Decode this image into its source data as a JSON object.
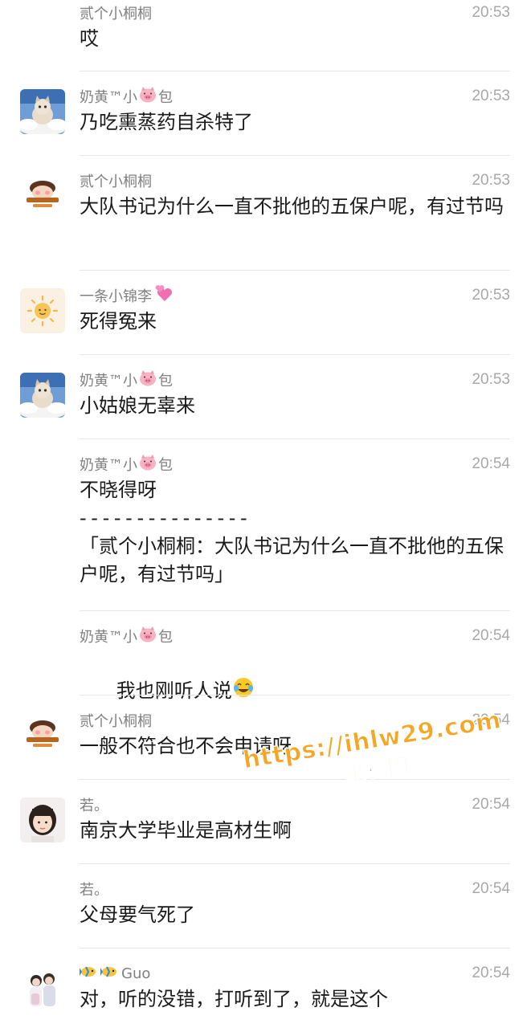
{
  "messages": [
    {
      "sender": "贰个小桐桐",
      "time": "20:53",
      "text": "哎",
      "avatar": "none"
    },
    {
      "sender": "奶黄™小",
      "sender_suffix": "包",
      "time": "20:53",
      "text": "乃吃熏蒸药自杀特了",
      "avatar": "cat-cloud"
    },
    {
      "sender": "贰个小桐桐",
      "time": "20:53",
      "text": "大队书记为什么一直不批他的五保户呢，有过节吗",
      "avatar": "cartoon-tongtong"
    },
    {
      "sender": "一条小锦李",
      "time": "20:53",
      "text": "死得冤来",
      "avatar": "sun"
    },
    {
      "sender": "奶黄™小",
      "sender_suffix": "包",
      "time": "20:53",
      "text": "小姑娘无辜来",
      "avatar": "cat-cloud"
    },
    {
      "sender": "奶黄™小",
      "sender_suffix": "包",
      "time": "20:54",
      "text": "不晓得呀",
      "quote_separator": "- - - - - - - - - - - - - - -",
      "quote": "「贰个小桐桐：大队书记为什么一直不批他的五保户呢，有过节吗」",
      "avatar": "none"
    },
    {
      "sender": "奶黄™小",
      "sender_suffix": "包",
      "time": "20:54",
      "text": "我也刚听人说",
      "avatar": "none"
    },
    {
      "sender": "贰个小桐桐",
      "time": "20:54",
      "text": "一般不符合也不会申请呀",
      "avatar": "cartoon-tongtong"
    },
    {
      "sender": "若。",
      "time": "20:54",
      "text": "南京大学毕业是高材生啊",
      "avatar": "girl-photo"
    },
    {
      "sender": "若。",
      "time": "20:54",
      "text": "父母要气死了",
      "avatar": "none"
    },
    {
      "sender": "Guo",
      "time": "20:54",
      "text": "对，听的没错，打听到了，就是这个",
      "avatar": "couple-photo"
    }
  ],
  "watermark": {
    "url": "https://ihlw29.com",
    "label": "黑料网"
  },
  "colors": {
    "sender": "#808080",
    "time": "#a8a8a8",
    "text": "#1a1a1a",
    "divider": "#e6e6e6",
    "watermark": "#f5a623"
  }
}
